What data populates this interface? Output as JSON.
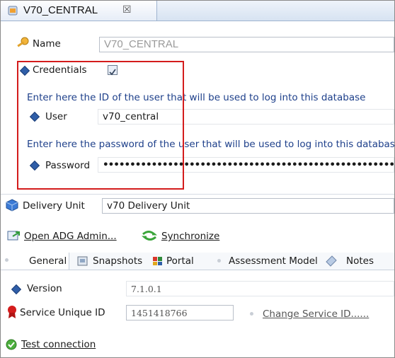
{
  "editor_tab": {
    "title": "V70_CENTRAL",
    "close": "☒"
  },
  "name_field": {
    "label": "Name",
    "value": "V70_CENTRAL"
  },
  "credentials": {
    "label": "Credentials",
    "checked": true
  },
  "user": {
    "help": "Enter here the ID of the user that will be used to log into this database",
    "label": "User",
    "value": "v70_central"
  },
  "password": {
    "help": "Enter here the password of the user that will be used to log into this database",
    "label": "Password",
    "value": "••••••••••••••••••••••••••••••••••••••••••••••••••••••••••••••"
  },
  "delivery_unit": {
    "label": "Delivery Unit",
    "value": "v70 Delivery Unit"
  },
  "actions": {
    "open_adg": "Open ADG Admin...",
    "synchronize": "Synchronize"
  },
  "tabs": [
    {
      "label": "General"
    },
    {
      "label": "Snapshots"
    },
    {
      "label": "Portal"
    },
    {
      "label": "Assessment Model"
    },
    {
      "label": "Notes"
    }
  ],
  "version": {
    "label": "Version",
    "value": "7.1.0.1"
  },
  "service": {
    "label": "Service Unique ID",
    "value": "1451418766",
    "change": "Change Service ID......"
  },
  "test_connection": {
    "label": "Test connection"
  },
  "colors": {
    "highlight": "#d41c1c",
    "diamond": "#2f5ea8"
  }
}
